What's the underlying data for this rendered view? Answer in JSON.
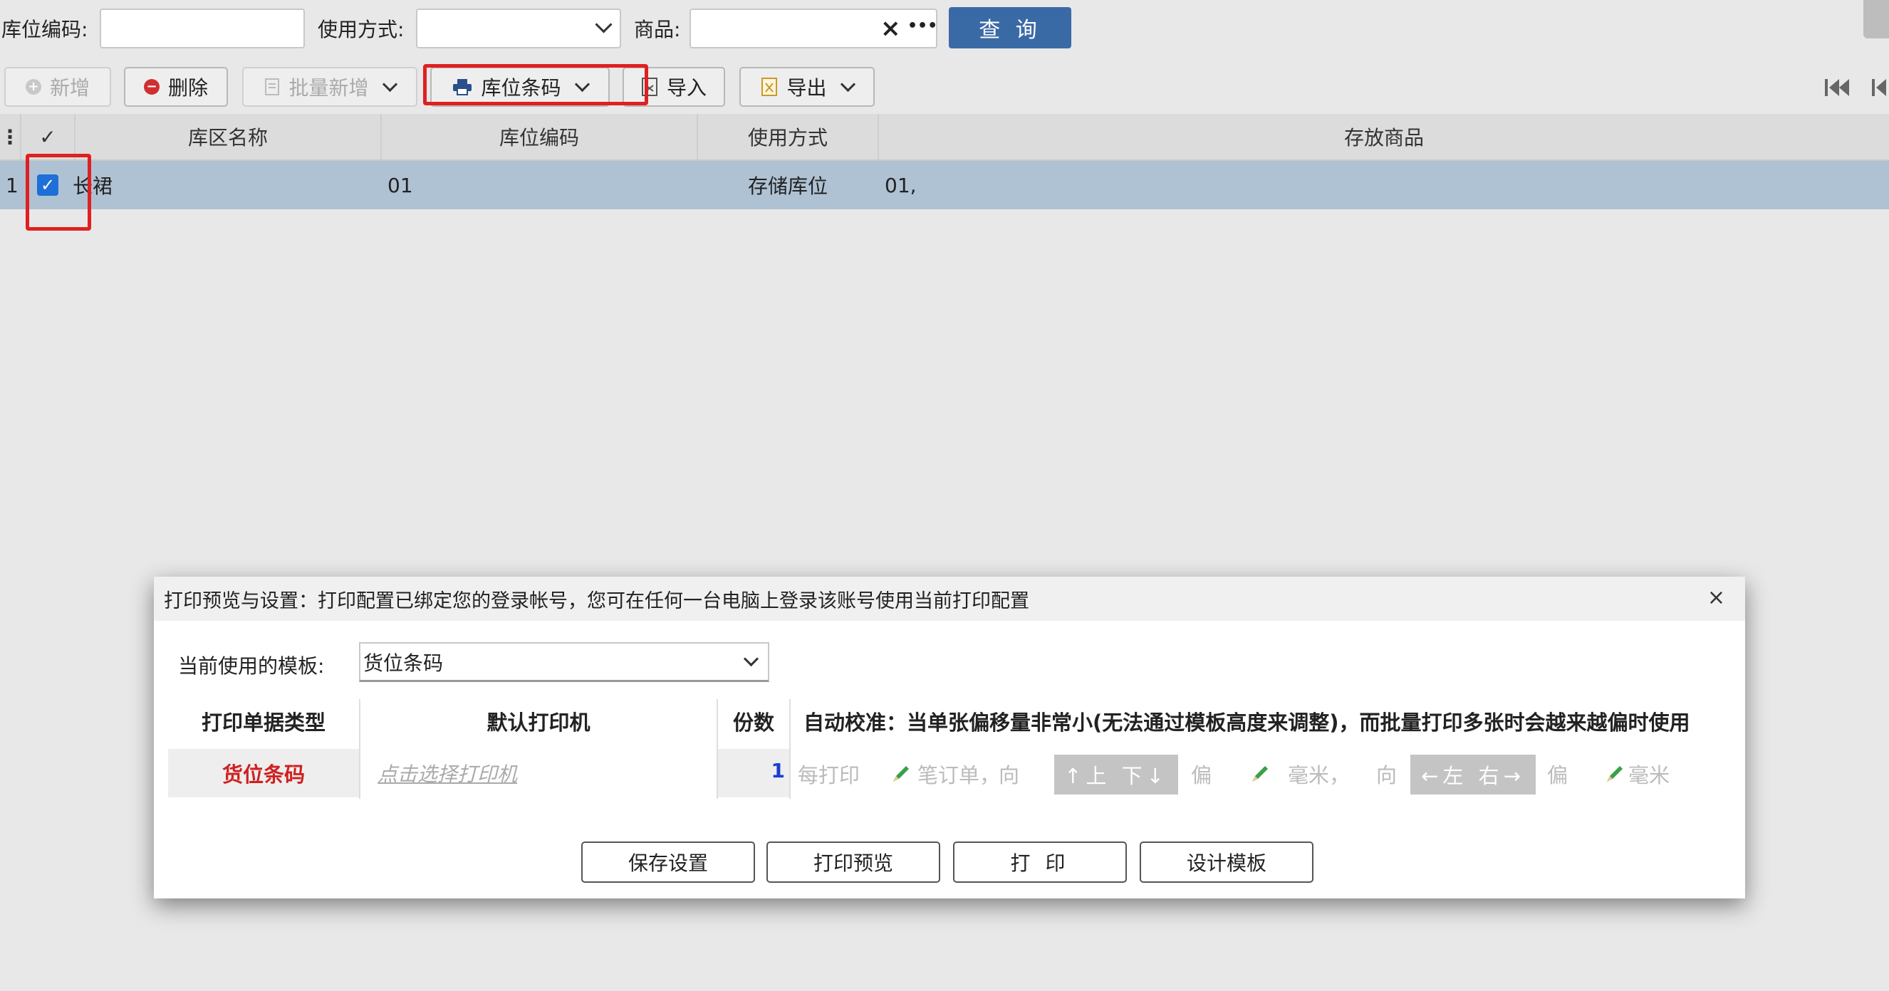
{
  "filters": {
    "location_code_label": "库位编码:",
    "usage_label": "使用方式:",
    "product_label": "商品:",
    "clear_glyph": "×",
    "more_glyph": "•••",
    "query_label": "查 询"
  },
  "toolbar": {
    "add_label": "新增",
    "delete_label": "删除",
    "batch_add_label": "批量新增",
    "barcode_label": "库位条码",
    "import_label": "导入",
    "export_label": "导出"
  },
  "table": {
    "headers": [
      "库区名称",
      "库位编码",
      "使用方式",
      "存放商品"
    ],
    "rows": [
      {
        "index": "1",
        "zone": "长裙",
        "code": "01",
        "usage": "存储库位",
        "goods": "01,"
      }
    ]
  },
  "dialog": {
    "title": "打印预览与设置：打印配置已绑定您的登录帐号，您可在任何一台电脑上登录该账号使用当前打印配置",
    "close_glyph": "×",
    "template_label": "当前使用的模板:",
    "template_value": "货位条码",
    "col_doc_type": "打印单据类型",
    "col_printer": "默认打印机",
    "col_copies": "份数",
    "col_calibrate": "自动校准：当单张偏移量非常小(无法通过模板高度来调整)，而批量打印多张时会越来越偏时使用",
    "row_doc_type": "货位条码",
    "row_printer": "点击选择打印机",
    "row_copies": "1",
    "cal_every": "每打印",
    "cal_orders": "笔订单，",
    "cal_dir1": "向",
    "cal_updown": "↑上 下↓",
    "cal_offset1": "偏",
    "cal_mm1": "毫米，",
    "cal_dir2": "向",
    "cal_leftright": "←左 右→",
    "cal_offset2": "偏",
    "cal_mm2": "毫米",
    "btn_save": "保存设置",
    "btn_preview": "打印预览",
    "btn_print": "打 印",
    "btn_design": "设计模板"
  },
  "colors": {
    "accent": "#3a6aa6",
    "selected_row": "#afc2d4",
    "highlight_box": "#e02020",
    "doc_type_text": "#d02020"
  }
}
